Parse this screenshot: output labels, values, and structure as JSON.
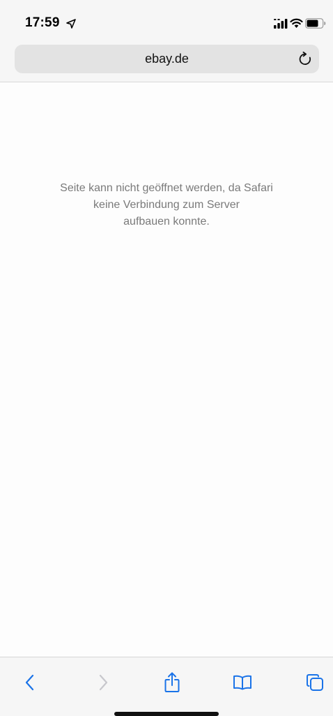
{
  "status_bar": {
    "time": "17:59",
    "icons": [
      "location-arrow-icon",
      "signal-icon",
      "wifi-icon",
      "battery-icon"
    ]
  },
  "address_bar": {
    "url": "ebay.de",
    "reload_icon": "reload-icon"
  },
  "error": {
    "line1": "Seite kann nicht geöffnet werden, da Safari",
    "line2": "keine Verbindung zum Server",
    "line3": "aufbauen konnte."
  },
  "toolbar": {
    "buttons": [
      "back-icon",
      "forward-icon",
      "share-icon",
      "bookmarks-icon",
      "tabs-icon"
    ],
    "accent_color": "#1a73e8",
    "disabled_color": "#c7c7cc"
  }
}
